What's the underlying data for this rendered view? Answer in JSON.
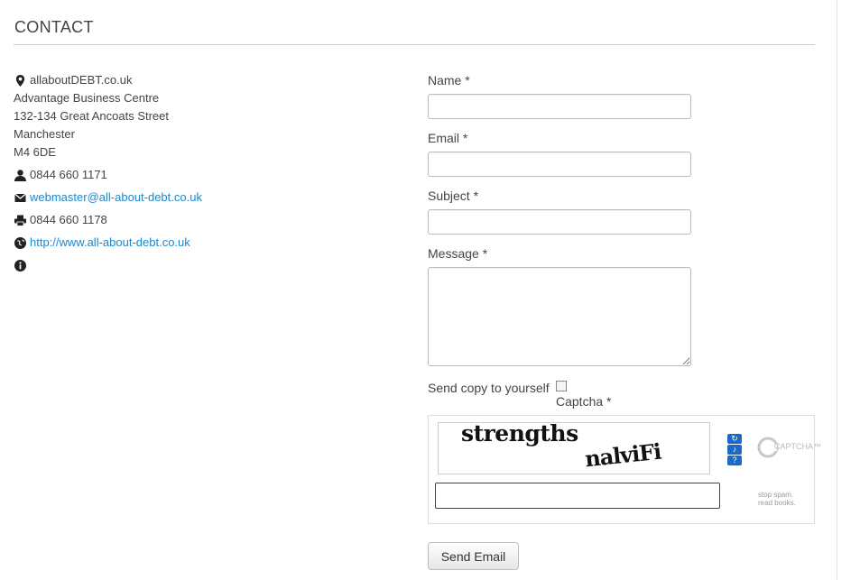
{
  "page": {
    "title": "CONTACT"
  },
  "contact": {
    "name": "allaboutDEBT.co.uk",
    "address_lines": [
      "Advantage Business Centre",
      "132-134 Great Ancoats Street",
      "Manchester",
      "M4 6DE"
    ],
    "phone": "0844 660 1171",
    "email": "webmaster@all-about-debt.co.uk",
    "fax": "0844 660 1178",
    "website": "http://www.all-about-debt.co.uk"
  },
  "form": {
    "name_label": "Name *",
    "email_label": "Email *",
    "subject_label": "Subject *",
    "message_label": "Message *",
    "copy_label": "Send copy to yourself",
    "captcha_label": "Captcha *",
    "captcha_words": [
      "strengths",
      "nalviFi"
    ],
    "recaptcha_brand": "CAPTCHA™",
    "recaptcha_tagline": [
      "stop spam.",
      "read books."
    ],
    "submit_label": "Send Email"
  },
  "colors": {
    "link": "#1e88c9",
    "recaptcha_button": "#1a6ac8"
  },
  "icons": [
    "map-marker-icon",
    "user-icon",
    "envelope-icon",
    "print-icon",
    "globe-icon",
    "info-icon",
    "refresh-icon",
    "audio-icon",
    "help-icon",
    "recaptcha-logo-icon"
  ]
}
